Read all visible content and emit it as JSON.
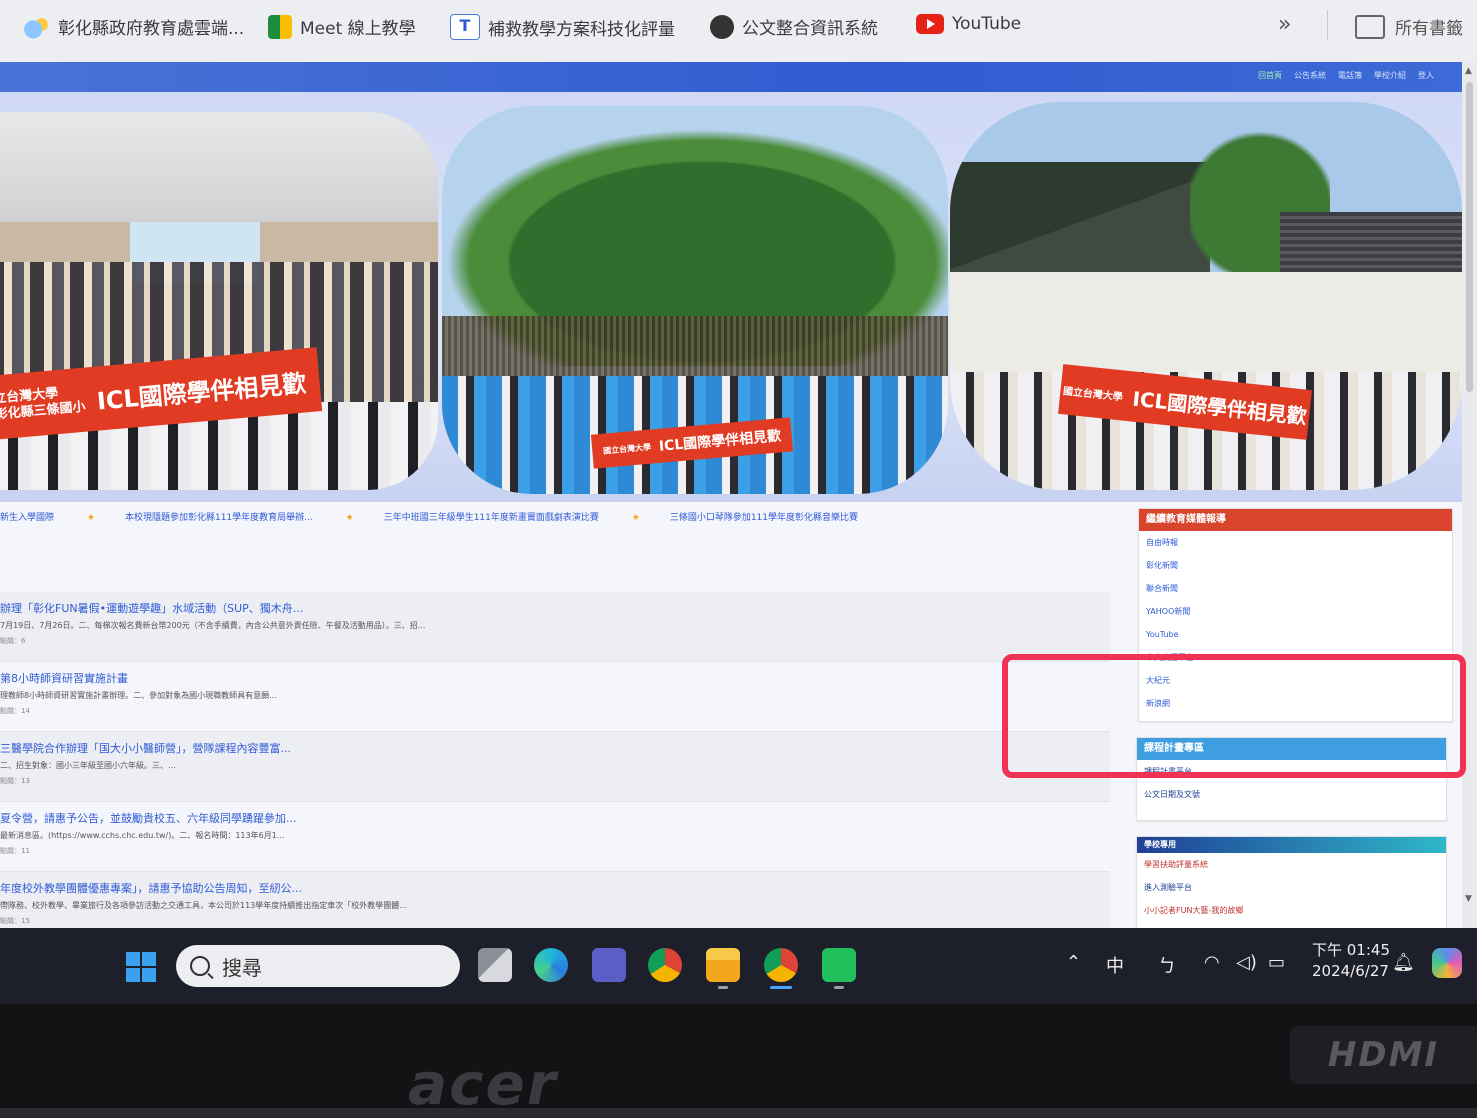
{
  "bookmarks": [
    {
      "label": "彰化縣政府教育處雲端...",
      "icon": "cloud-icon"
    },
    {
      "label": "Meet 線上教學",
      "icon": "meet-icon"
    },
    {
      "label": "補救教學方案科技化評量",
      "icon": "tc-icon"
    },
    {
      "label": "公文整合資訊系統",
      "icon": "globe-icon"
    },
    {
      "label": "YouTube",
      "icon": "youtube-icon"
    }
  ],
  "bookmarks_more": "»",
  "bookmarks_folder": "所有書籤",
  "top_links": [
    "回首頁",
    "公告系統",
    "電話簿",
    "學校介紹",
    "登入"
  ],
  "banner_texts": [
    "立台灣大學",
    "彰化縣三條國小",
    "ICL國際學伴相見歡",
    "國立台灣大學",
    "ICL國際學伴相見歡",
    "國立台灣大學",
    "ICL國際學伴相見歡"
  ],
  "marquee": [
    "新生入學國際",
    "本校現隱題參加彰化縣111學年度教育局舉辦...",
    "三年中班國三年級學生111年度新畫竇面戲劇表演比賽",
    "三條國小口琴隊參加111學年度彰化縣音樂比賽"
  ],
  "news": [
    {
      "title": "辦理「彰化FUN暑假•運動遊學趣」水域活動（SUP、獨木舟...",
      "desc": "7月19日、7月26日。二、每梯次報名費新台幣200元（不含手續費，內含公共意外責任險、午餐及活動用品）。三、招...",
      "meta": "點閱：6"
    },
    {
      "title": "第8小時師資研習實施計畫",
      "desc": "理教師8小時師資研習實施計畫辦理。二、參加對象為國小現職教師具有意願...",
      "meta": "點閱：14"
    },
    {
      "title": "三醫學院合作辦理「国大小小醫師營」，營隊課程內容豐富...",
      "desc": "二、招生對象：國小三年級至國小六年級。三、...",
      "meta": "點閱：13"
    },
    {
      "title": "夏令營，請惠予公告，並鼓勵貴校五、六年級同學踴躍參加...",
      "desc": "最新消息區。(https://www.cchs.chc.edu.tw/)。二、報名時間：113年6月1...",
      "meta": "點閱：11"
    },
    {
      "title": "年度校外教學團體優惠專案」，請惠予協助公告周知，至紉公...",
      "desc": "帶隊務、校外教學、畢業旅行及各項參訪活動之交通工具，本公司於113學年度持續推出指定車次「校外教學團體...",
      "meta": "點閱：15"
    }
  ],
  "sidebar_media": {
    "title": "繼續教育媒體報導",
    "items": [
      "自由時報",
      "彰化新聞",
      "聯合新聞",
      "YAHOO新聞",
      "YouTube",
      "中央廣播平台",
      "大紀元",
      "新浪網"
    ]
  },
  "sidebar_curriculum": {
    "title": "課程計畫專區",
    "items": [
      "課程計畫平台",
      "公文日期及文號"
    ]
  },
  "sidebar_learning": {
    "title": "學校專用",
    "items": [
      "學習扶助評量系統",
      "進入測驗平台",
      "小小記者FUN大藝-我的故鄉"
    ]
  },
  "taskbar": {
    "search_placeholder": "搜尋",
    "ime": "中",
    "time": "下午 01:45",
    "date": "2024/6/27"
  },
  "brand": "acer",
  "hdmi_label": "HDMI",
  "colors": {
    "accent": "#2f5bd6",
    "highlight": "#f03355",
    "sidebar_red": "#d9452c",
    "sidebar_blue": "#3f9ee0"
  }
}
